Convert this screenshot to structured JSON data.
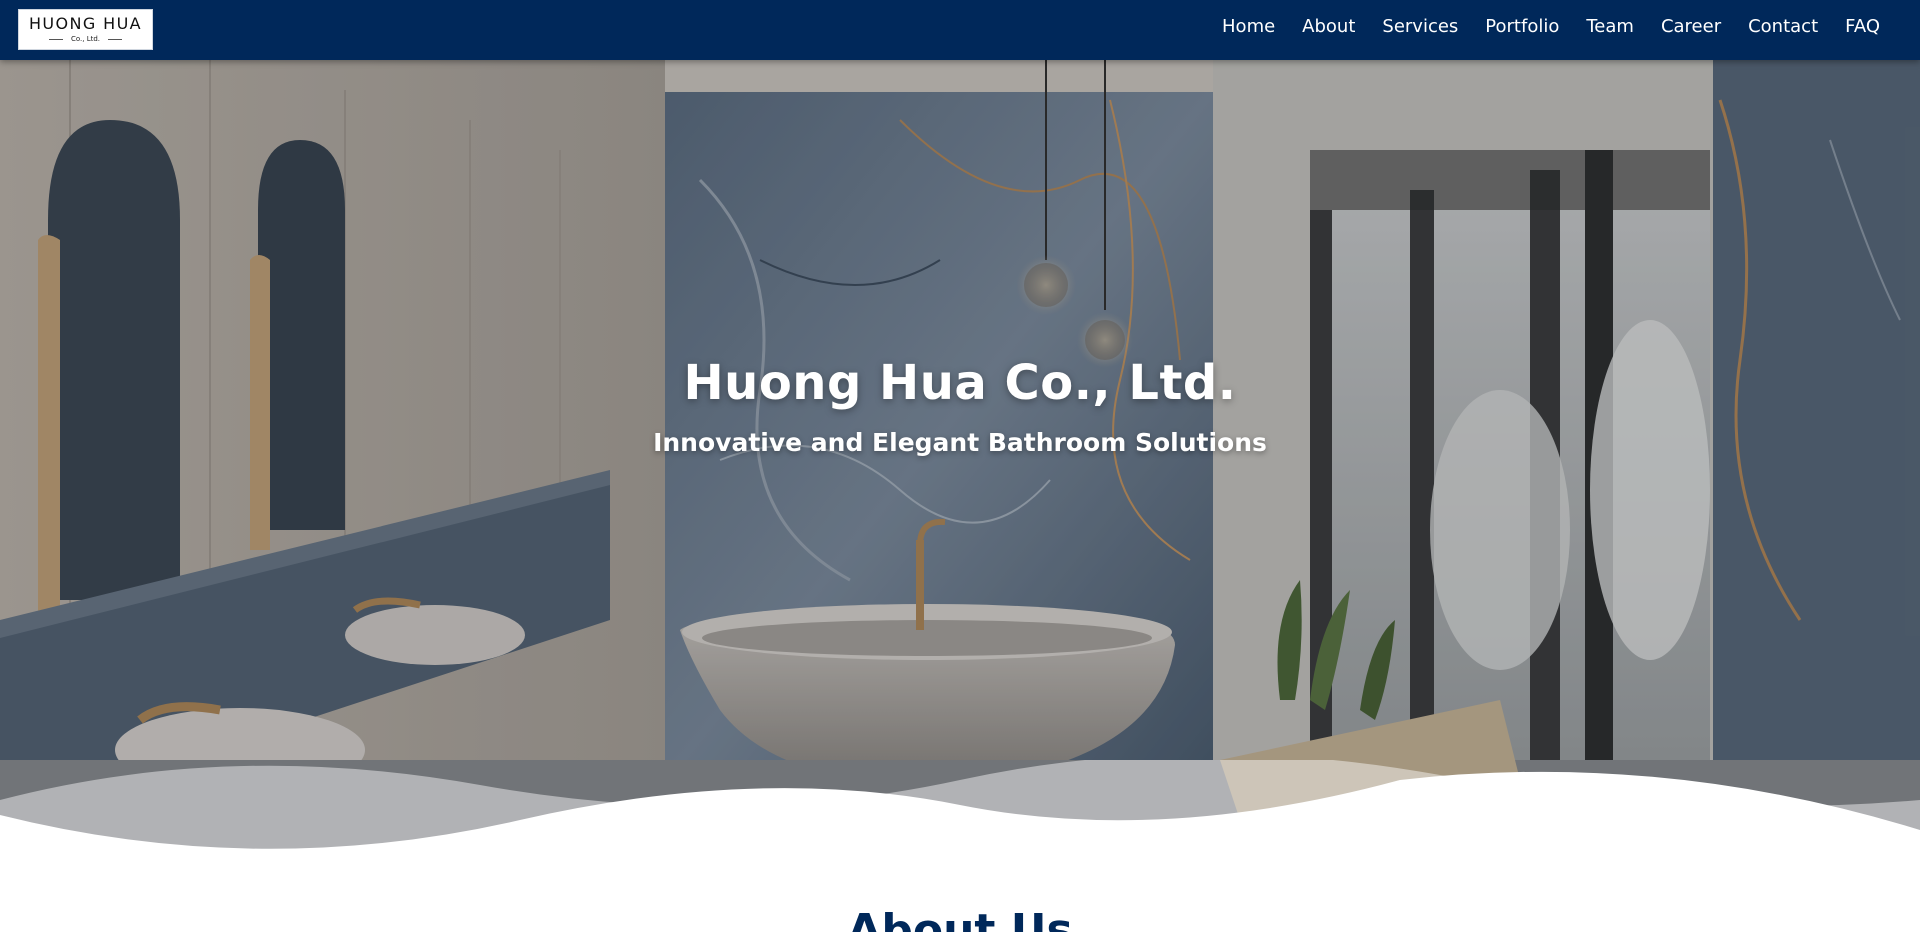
{
  "brand": {
    "logo_main": "HUONG HUA",
    "logo_sub": "Co., Ltd.",
    "navbar_color": "#00285a"
  },
  "nav": {
    "items": [
      {
        "label": "Home"
      },
      {
        "label": "About"
      },
      {
        "label": "Services"
      },
      {
        "label": "Portfolio"
      },
      {
        "label": "Team"
      },
      {
        "label": "Career"
      },
      {
        "label": "Contact"
      },
      {
        "label": "FAQ"
      }
    ]
  },
  "hero": {
    "title": "Huong Hua Co., Ltd.",
    "subtitle": "Innovative and Elegant Bathroom Solutions"
  },
  "about": {
    "heading": "About Us"
  }
}
